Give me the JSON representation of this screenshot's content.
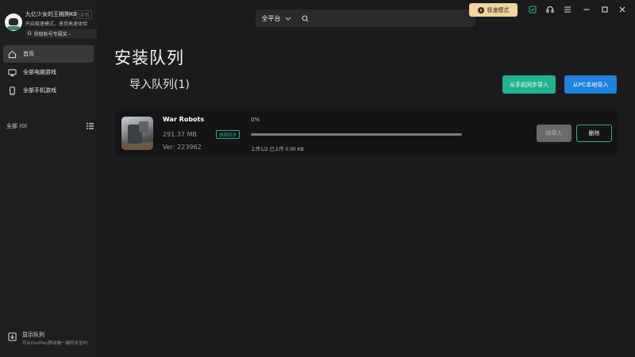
{
  "profile": {
    "username": "九亿少女的王桃狗K8",
    "tag": "已实名",
    "desc": "开启极速模式，享受高速体验",
    "invite": "获取账号专属奖 ›"
  },
  "nav": [
    {
      "label": "首页",
      "icon": "home-icon"
    },
    {
      "label": "全部电脑游戏",
      "icon": "monitor-icon"
    },
    {
      "label": "全部手机游戏",
      "icon": "phone-icon"
    }
  ],
  "filter": {
    "label": "全部 (0)"
  },
  "bottom_queue": {
    "title": "显示队列",
    "desc": "可从OurPlay移动端一键同步至PC"
  },
  "topbar": {
    "platform": "全平台",
    "search_placeholder": "",
    "speed_mode": "极速模式"
  },
  "page": {
    "title": "安装队列",
    "queue_title": "导入队列(1)"
  },
  "actions": {
    "sync_phone": "从手机同步导入",
    "import_pc": "从PC本地导入"
  },
  "game": {
    "name": "War Robots",
    "size": "291.37 MB",
    "badge": "游戏同步",
    "version": "Ver: 223962",
    "progress_text": "0%",
    "progress": 0,
    "upload_status": "上传1/2 已上传 0.00 KB",
    "wait_label": "待导入",
    "delete_label": "删除"
  },
  "colors": {
    "background": "#1b1b1d",
    "accent_green": "#20b391",
    "accent_blue": "#1f82db",
    "speed_gold": "#f1d4a0"
  }
}
